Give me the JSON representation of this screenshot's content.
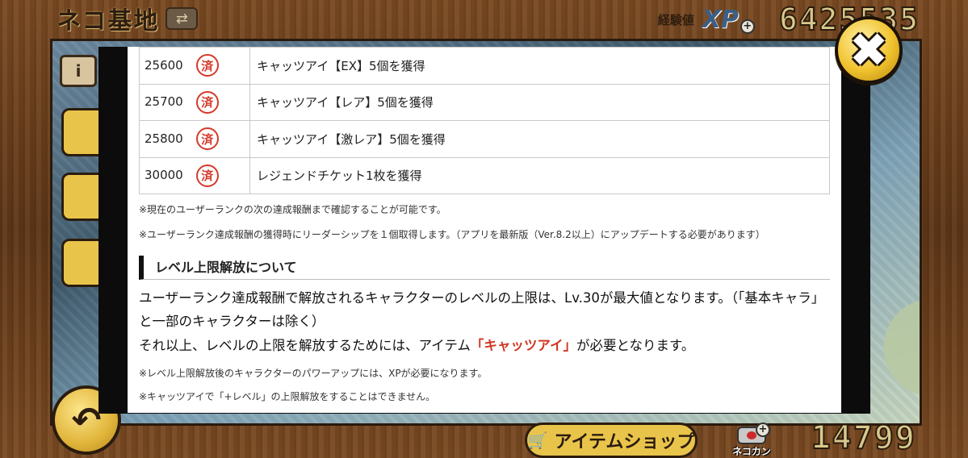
{
  "header": {
    "title": "ネコ基地",
    "xp_caption": "経験値",
    "xp_label": "XP",
    "xp_value": "6425535"
  },
  "bottom_bar": {
    "item_shop_label": "アイテムショップ",
    "neko_can_label": "ネコカン",
    "neko_can_value": "14799"
  },
  "modal": {
    "rewards": [
      {
        "rank": "25600",
        "stamp": "済",
        "reward": "キャッツアイ【EX】5個を獲得"
      },
      {
        "rank": "25700",
        "stamp": "済",
        "reward": "キャッツアイ【レア】5個を獲得"
      },
      {
        "rank": "25800",
        "stamp": "済",
        "reward": "キャッツアイ【激レア】5個を獲得"
      },
      {
        "rank": "30000",
        "stamp": "済",
        "reward": "レジェンドチケット1枚を獲得"
      }
    ],
    "note_1": "※現在のユーザーランクの次の達成報酬まで確認することが可能です。",
    "note_2": "※ユーザーランク達成報酬の獲得時にリーダーシップを１個取得します。（アプリを最新版（Ver.8.2以上）にアップデートする必要があります）",
    "section_heading": "レベル上限解放について",
    "body_1": "ユーザーランク達成報酬で解放されるキャラクターのレベルの上限は、Lv.30が最大値となります。（「基本キャラ」と一部のキャラクターは除く）",
    "body_2_prefix": "それ以上、レベルの上限を解放するためには、アイテム",
    "body_2_highlight": "「キャッツアイ」",
    "body_2_suffix": "が必要となります。",
    "note_3": "※レベル上限解放後のキャラクターのパワーアップには、XPが必要になります。",
    "note_4": "※キャッツアイで「+レベル」の上限解放をすることはできません。"
  },
  "colors": {
    "highlight": "#d0361f",
    "stamp": "#d53a2a",
    "button_gold": "#e9c44a"
  },
  "icons": {
    "close": "close-icon",
    "back": "back-arrow-icon",
    "cart": "cart-icon",
    "info": "info-icon"
  }
}
